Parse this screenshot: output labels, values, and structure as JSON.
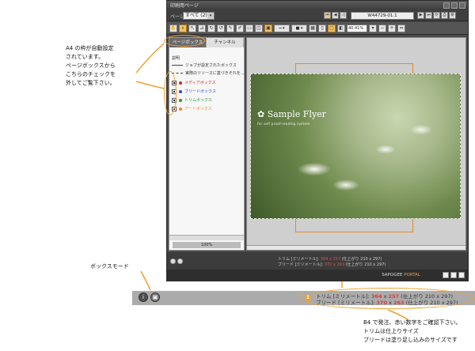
{
  "window": {
    "title": "印刷用ページ",
    "page_label": "ページ",
    "page_select": "すべて (2)",
    "doc_id": "W44729-01.1",
    "zoom": "40.41%"
  },
  "panel": {
    "tabs": [
      "ページボックス",
      "チャンネル"
    ],
    "section": "説明",
    "legend": [
      "ジョブが設定されたボックス",
      "実際のリソースに基づきそれを..."
    ],
    "boxes": [
      {
        "label": "メディアボックス",
        "color": "#d62828"
      },
      {
        "label": "ブリードボックス",
        "color": "#2b4fd6"
      },
      {
        "label": "トリムボックス",
        "color": "#2a9a3a"
      },
      {
        "label": "アートボックス",
        "color": "#f08a1a"
      }
    ],
    "zoom_label": "100%"
  },
  "canvas": {
    "brand": "✿ Sample Flyer",
    "tagline": "for self proof-reading system"
  },
  "status": {
    "trim_label": "トリム [ミリメートル]:",
    "trim_value": "364 x 257",
    "trim_note": "(仕上がり 210 x 297)",
    "bleed_label": "ブリード [ミリメートル]:",
    "bleed_value": "370 x 263",
    "bleed_note": "(仕上がり 210 x 297)"
  },
  "footer": {
    "brand_a": "SAPOGEE",
    "brand_b": "PORTAL"
  },
  "strip": {
    "badge": "1",
    "trim_label": "トリム [ミリメートル]:",
    "trim_value": "364",
    "trim_x": "x",
    "trim_value2": "257",
    "trim_note": "(仕上がり 210 x 297)",
    "bleed_label": "ブリード [ミリメートル]:",
    "bleed_value": "370",
    "bleed_x": "x",
    "bleed_value2": "263",
    "bleed_note": "(仕上がり 210 x 297)"
  },
  "notes": {
    "left": [
      "A4 の枠が自動設定",
      "されています。",
      "ページボックスから",
      "こちらのチェックを",
      "外してご覧下さい。"
    ],
    "boxmode": "ボックスモード",
    "bottom": [
      "B4 で発注、赤い数字をご確認下さい。",
      "トリムは仕上りサイズ",
      "ブリードは塗り足し込みのサイズです"
    ]
  },
  "colors": {
    "accent": "#f0a030",
    "red_value": "#d63c3c"
  }
}
